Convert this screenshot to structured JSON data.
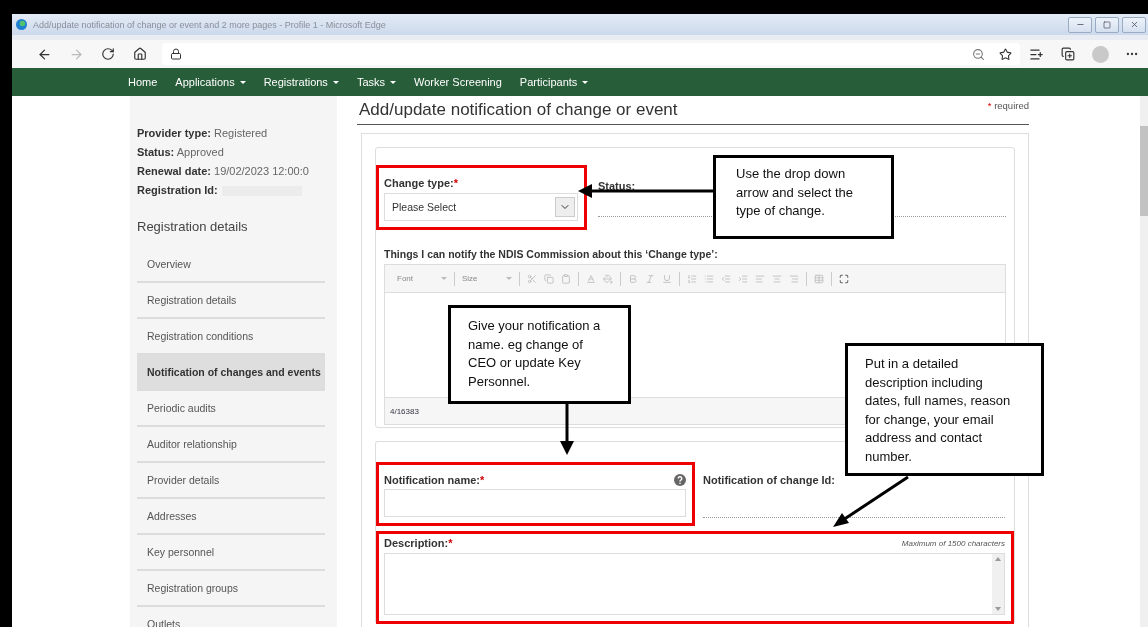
{
  "browser": {
    "title": "Add/update notification of change or event and 2 more pages - Profile 1 - Microsoft Edge"
  },
  "nav": [
    {
      "label": "Home",
      "dropdown": false
    },
    {
      "label": "Applications",
      "dropdown": true
    },
    {
      "label": "Registrations",
      "dropdown": true
    },
    {
      "label": "Tasks",
      "dropdown": true
    },
    {
      "label": "Worker Screening",
      "dropdown": false
    },
    {
      "label": "Participants",
      "dropdown": true
    }
  ],
  "sidebar": {
    "info": [
      {
        "label": "Provider type:",
        "value": "Registered"
      },
      {
        "label": "Status:",
        "value": "Approved"
      },
      {
        "label": "Renewal date:",
        "value": "19/02/2023 12:00:0"
      },
      {
        "label": "Registration Id:"
      }
    ],
    "heading": "Registration details",
    "items": [
      {
        "label": "Overview",
        "selected": false
      },
      {
        "label": "Registration details",
        "selected": false
      },
      {
        "label": "Registration conditions",
        "selected": false
      },
      {
        "label": "Notification of changes and events",
        "selected": true
      },
      {
        "label": "Periodic audits",
        "selected": false
      },
      {
        "label": "Auditor relationship",
        "selected": false
      },
      {
        "label": "Provider details",
        "selected": false
      },
      {
        "label": "Addresses",
        "selected": false
      },
      {
        "label": "Key personnel",
        "selected": false
      },
      {
        "label": "Registration groups",
        "selected": false
      },
      {
        "label": "Outlets",
        "selected": false
      }
    ]
  },
  "page": {
    "title": "Add/update notification of change or event",
    "required_mark": "*",
    "required_note": "required"
  },
  "form": {
    "change_type": {
      "label": "Change type:",
      "required_mark": "*",
      "value": "Please Select",
      "highlighted": true
    },
    "status": {
      "label": "Status:"
    },
    "things_label": "Things I can notify the NDIS Commission about this ‘Change type’:",
    "editor": {
      "font": "Font",
      "size": "Size",
      "counter": "4/16383"
    },
    "notification_name": {
      "label": "Notification name:",
      "required_mark": "*",
      "highlighted": true
    },
    "notification_id": {
      "label": "Notification of change Id:"
    },
    "description": {
      "label": "Description:",
      "required_mark": "*",
      "hint": "Maximum of 1500 characters",
      "highlighted": true
    }
  },
  "callouts": [
    {
      "text": "Use the drop down arrow and select the type of change."
    },
    {
      "text": "Give your notification a name. eg change of CEO or update Key Personnel."
    },
    {
      "text": "Put in a detailed description including dates, full names, reason for change, your email address and contact number."
    }
  ]
}
